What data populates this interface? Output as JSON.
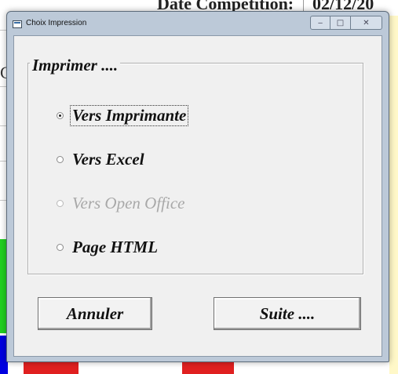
{
  "background": {
    "header_label": "Date Compétition:",
    "date_value": "02/12/20",
    "left_fragment": "C"
  },
  "window": {
    "title": "Choix Impression",
    "icons": {
      "app": "window-app-icon",
      "minimize": "minimize-icon",
      "maximize": "maximize-icon",
      "close": "close-icon"
    }
  },
  "group": {
    "legend": "Imprimer ....",
    "options": [
      {
        "label": "Vers Imprimante",
        "checked": true,
        "enabled": true
      },
      {
        "label": "Vers Excel",
        "checked": false,
        "enabled": true
      },
      {
        "label": "Vers Open Office",
        "checked": false,
        "enabled": false
      },
      {
        "label": "Page HTML",
        "checked": false,
        "enabled": true
      }
    ]
  },
  "buttons": {
    "cancel_label": "Annuler",
    "next_label": "Suite ...."
  },
  "colors": {
    "client_bg": "#f0f0f0",
    "frame": "#bcc9d8",
    "disabled_text": "#a8a8a8"
  }
}
